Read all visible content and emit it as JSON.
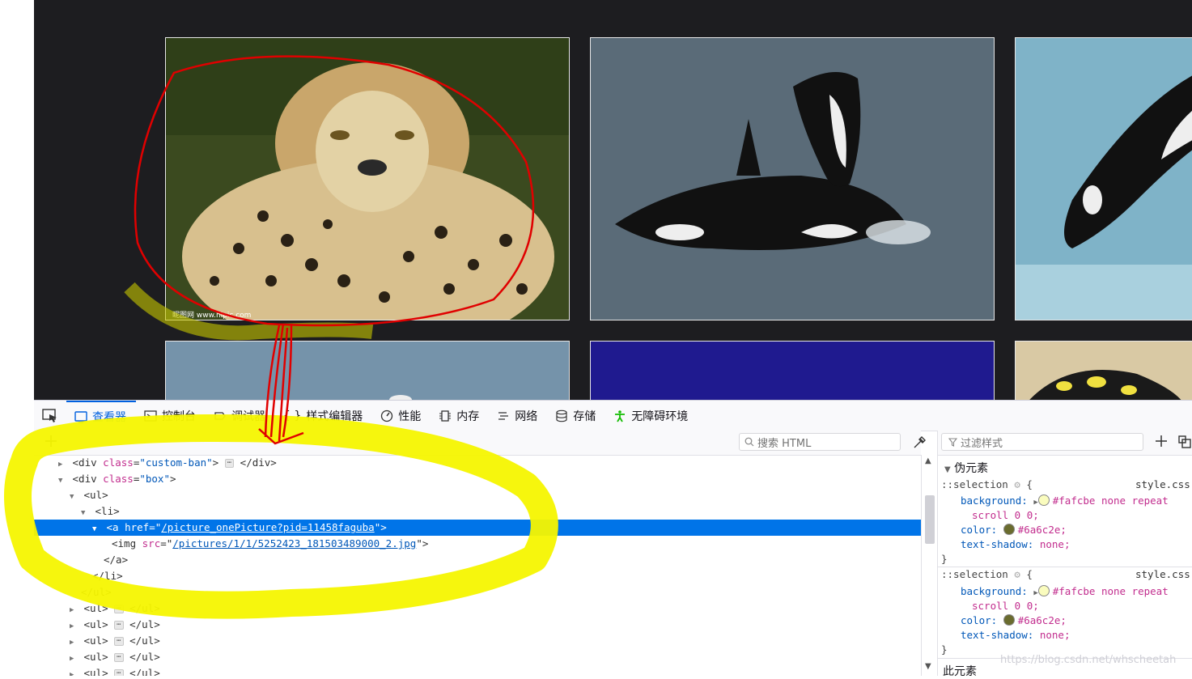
{
  "devtools_tabs": [
    {
      "label": "查看器",
      "icon": "inspector-icon",
      "active": true
    },
    {
      "label": "控制台",
      "icon": "console-icon"
    },
    {
      "label": "调试器",
      "icon": "debugger-icon"
    },
    {
      "label": "样式编辑器",
      "icon": "style-editor-icon",
      "prefix": "{ }"
    },
    {
      "label": "性能",
      "icon": "performance-icon"
    },
    {
      "label": "内存",
      "icon": "memory-icon"
    },
    {
      "label": "网络",
      "icon": "network-icon"
    },
    {
      "label": "存储",
      "icon": "storage-icon"
    },
    {
      "label": "无障碍环境",
      "icon": "accessibility-icon"
    }
  ],
  "markup": {
    "search_placeholder": "搜索 HTML",
    "lines": {
      "l0": {
        "tag_open": "<div ",
        "attr": "class",
        "val": "\"custom-ban\"",
        "close": ">",
        "end": "</div>"
      },
      "l1": {
        "tag_open": "<div ",
        "attr": "class",
        "val": "\"box\"",
        "close": ">"
      },
      "l2": "<ul>",
      "l3": "<li>",
      "l4": {
        "tag_open": "<a ",
        "attr": "href",
        "eq": "=\"",
        "link": "/picture_onePicture?pid=11458faguba",
        "close": "\">"
      },
      "l5": {
        "tag_open": "<img ",
        "attr": "src",
        "eq": "=\"",
        "link": "/pictures/1/1/5252423_181503489000_2.jpg",
        "close": "\">"
      },
      "l6": "</a>",
      "l7": "</li>",
      "l8": "</ul>",
      "collapsed_open": "<ul>",
      "collapsed_close": "</ul>",
      "ellipsis": "⋯"
    }
  },
  "rules": {
    "filter_placeholder": "过滤样式",
    "pseudo_header": "伪元素",
    "selector": "::selection",
    "brace_open": "{",
    "brace_close": "}",
    "source": "style.css",
    "bg_prop": "background:",
    "bg_value": "#fafcbe none repeat",
    "bg_value2": "scroll 0 0;",
    "color_prop": "color:",
    "color_value": "#6a6c2e;",
    "shadow_prop": "text-shadow:",
    "shadow_value": "none;",
    "next_header": "此元素",
    "swatch_bg": "#fafcbe",
    "swatch_color": "#6a6c2e"
  },
  "watermark": "https://blog.csdn.net/whscheetah",
  "colors": {
    "accent": "#0074e8",
    "annotation_red": "#e00000",
    "annotation_yellow": "#f5f500"
  }
}
